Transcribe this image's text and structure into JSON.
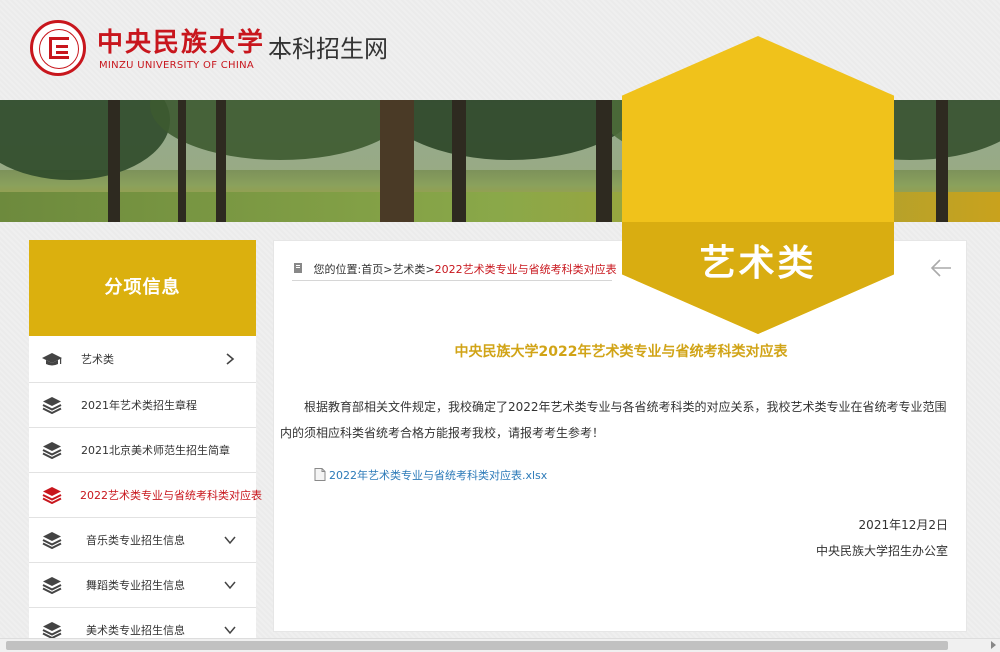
{
  "header": {
    "logo_cn": "中央民族大学",
    "logo_en": "MINZU UNIVERSITY OF CHINA",
    "site_title": "本科招生网"
  },
  "badge": {
    "label": "艺术类",
    "color": "#f0c21b"
  },
  "sidebar": {
    "title": "分项信息",
    "items": [
      {
        "label": "艺术类",
        "icon": "graduation-cap-icon",
        "arrow": "chevron-right-icon"
      },
      {
        "label": "2021年艺术类招生章程",
        "icon": "layers-icon"
      },
      {
        "label": "2021北京美术师范生招生简章",
        "icon": "layers-icon"
      },
      {
        "label": "2022艺术类专业与省统考科类对应表",
        "icon": "layers-icon",
        "active": true
      },
      {
        "label": "音乐类专业招生信息",
        "icon": "layers-icon",
        "arrow": "chevron-down-icon"
      },
      {
        "label": "舞蹈类专业招生信息",
        "icon": "layers-icon",
        "arrow": "chevron-down-icon"
      },
      {
        "label": "美术类专业招生信息",
        "icon": "layers-icon",
        "arrow": "chevron-down-icon"
      }
    ]
  },
  "breadcrumb": {
    "prefix": "您的位置:",
    "home": "首页",
    "sep1": ">",
    "section": "艺术类",
    "sep2": ">",
    "current": "2022艺术类专业与省统考科类对应表"
  },
  "article": {
    "title": "中央民族大学2022年艺术类专业与省统考科类对应表",
    "body": "根据教育部相关文件规定，我校确定了2022年艺术类专业与各省统考科类的对应关系，我校艺术类专业在省统考专业范围内的须相应科类省统考合格方能报考我校，请报考考生参考！",
    "attachment": "2022年艺术类专业与省统考科类对应表.xlsx",
    "date": "2021年12月2日",
    "signature": "中央民族大学招生办公室"
  },
  "colors": {
    "accent_gold": "#dbb00e",
    "brand_red": "#c8161d",
    "link_blue": "#2c7ab8"
  }
}
